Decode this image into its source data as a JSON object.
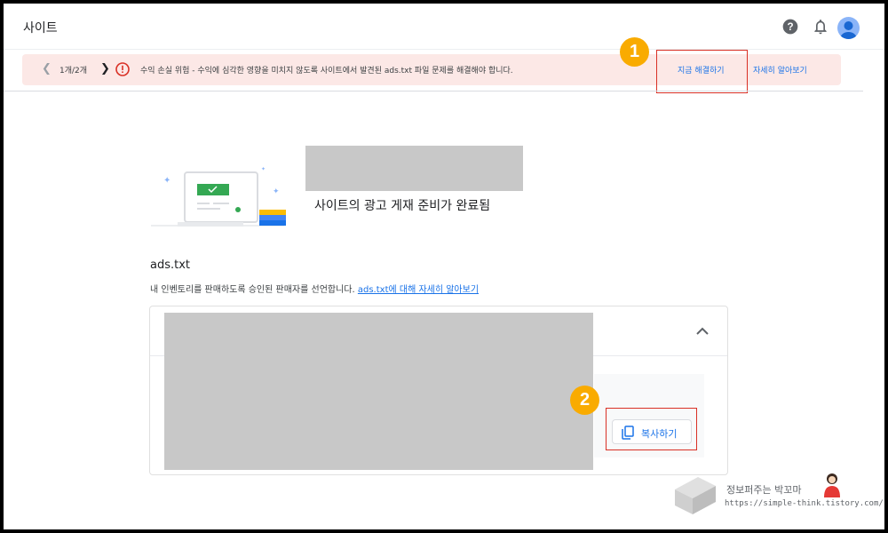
{
  "header": {
    "title": "사이트",
    "help_icon": "help-circle-icon",
    "bell_icon": "bell-icon",
    "avatar_icon": "account-avatar-icon"
  },
  "alert": {
    "pager": "1개/2개",
    "message": "수익 손실 위험 - 수익에 심각한 영향을 미치지 않도록 사이트에서 발견된 ads.txt 파일 문제를 해결해야 합니다.",
    "fix_now": "지금 해결하기",
    "learn_more": "자세히 알아보기",
    "background": "#fce8e6",
    "icon_color": "#d93025"
  },
  "steps": {
    "one": "1",
    "two": "2"
  },
  "site": {
    "ready_text": "사이트의 광고 게재 준비가 완료됨"
  },
  "ads_txt": {
    "title": "ads.txt",
    "description": "내 인벤토리를 판매하도록 승인된 판매자를 선언합니다.",
    "link_text": "ads.txt에 대해 자세히 알아보기",
    "copy_label": "복사하기"
  },
  "watermark": {
    "name": "정보퍼주는 박꼬마",
    "url": "https://simple-think.tistory.com/"
  },
  "colors": {
    "accent": "#1a73e8",
    "badge": "#f9ab00",
    "highlight": "#d93025"
  }
}
